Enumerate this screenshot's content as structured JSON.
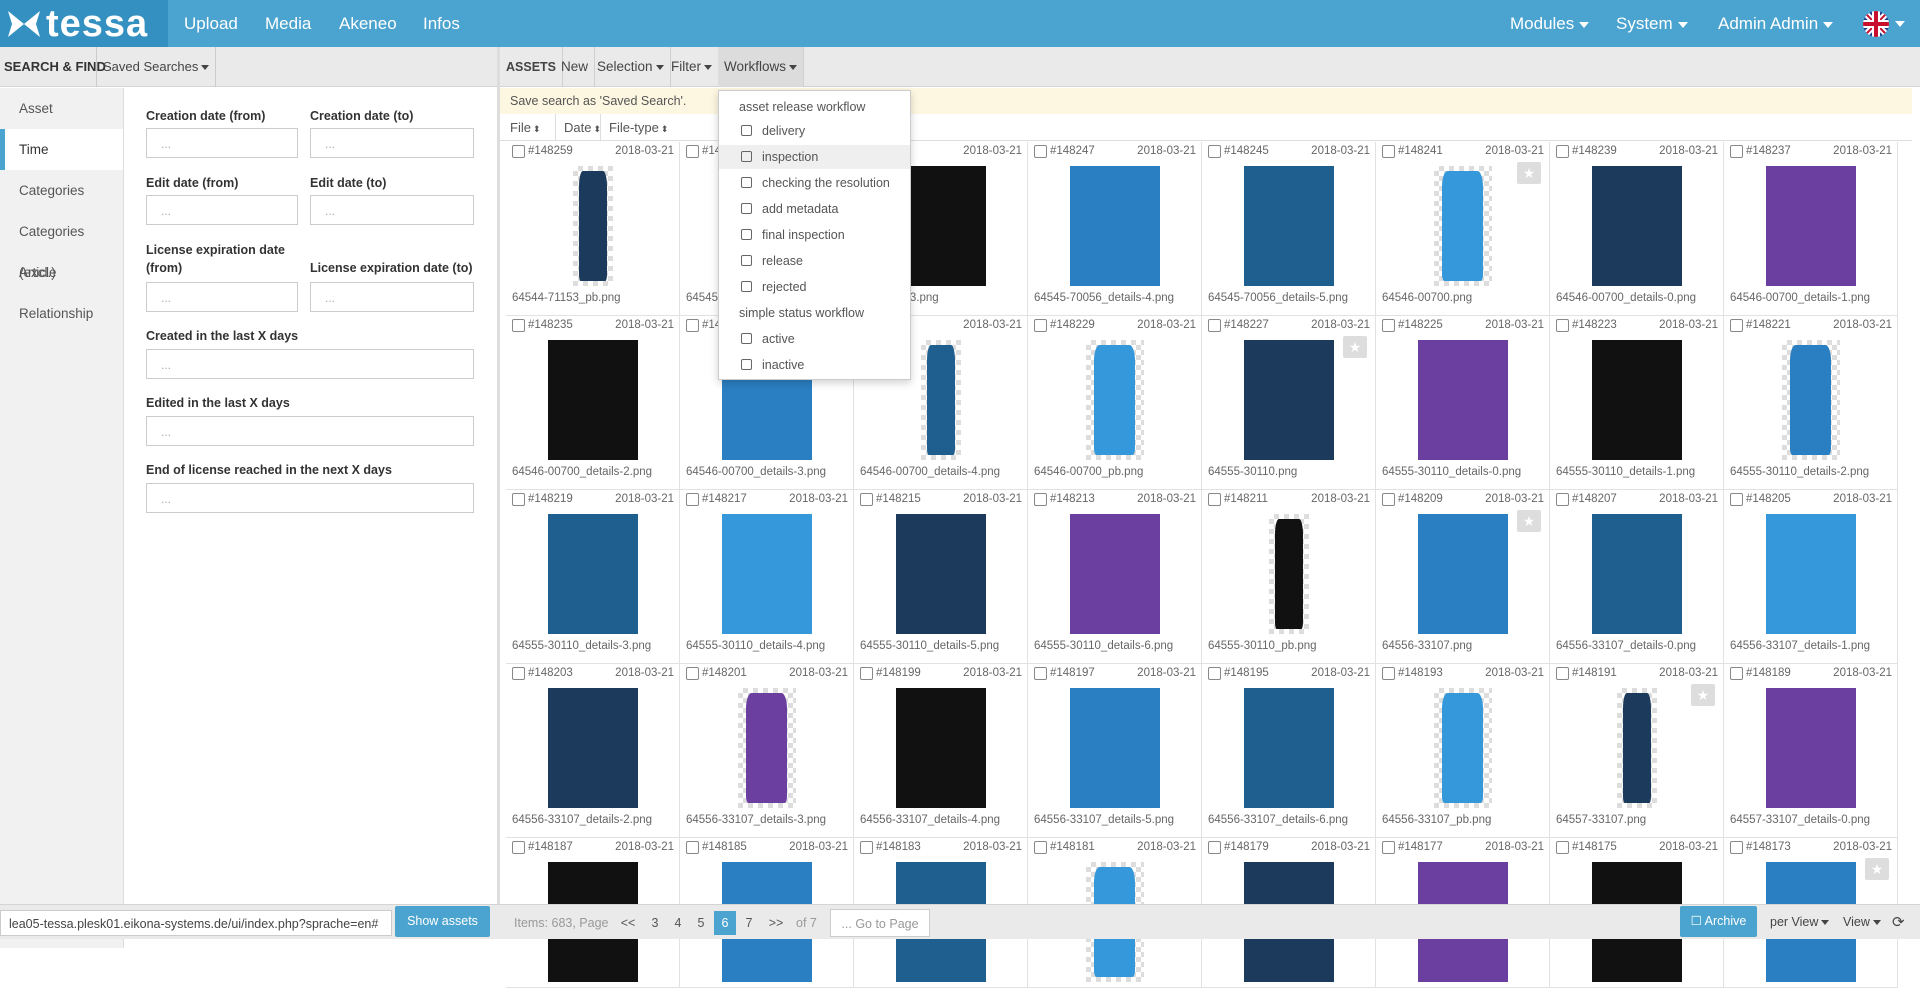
{
  "app": {
    "logo_text": "tessa"
  },
  "nav": {
    "left": [
      "Upload",
      "Media",
      "Akeneo",
      "Infos"
    ],
    "modules": "Modules",
    "system": "System",
    "user": "Admin Admin"
  },
  "colors": {
    "accent": "#4ba3cf",
    "logo_bg": "#3390c1",
    "save_bar": "#fdf7e1"
  },
  "search": {
    "title": "SEARCH & FIND",
    "saved_searches": "Saved Searches",
    "tabs": [
      "Asset",
      "Time",
      "Categories",
      "Categories (excl.)",
      "Article",
      "Relationship"
    ],
    "active_tab": "Time",
    "fields": {
      "creation_from": {
        "label": "Creation date (from)",
        "placeholder": "..."
      },
      "creation_to": {
        "label": "Creation date (to)",
        "placeholder": "..."
      },
      "edit_from": {
        "label": "Edit date (from)",
        "placeholder": "..."
      },
      "edit_to": {
        "label": "Edit date (to)",
        "placeholder": "..."
      },
      "license_from": {
        "label_1": "License expiration date",
        "label_2": "(from)",
        "placeholder": "..."
      },
      "license_to": {
        "label": "License expiration date (to)",
        "placeholder": "..."
      },
      "created_last": {
        "label": "Created in the last X days",
        "placeholder": "..."
      },
      "edited_last": {
        "label": "Edited in the last X days",
        "placeholder": "..."
      },
      "license_end": {
        "label": "End of license reached in the next X days",
        "placeholder": "..."
      }
    }
  },
  "toolbar": {
    "assets": "ASSETS",
    "new": "New",
    "selection": "Selection",
    "filter": "Filter",
    "workflows": "Workflows"
  },
  "save_search_text": "Save search as 'Saved Search'.",
  "sorts": [
    "File",
    "Date",
    "File-type"
  ],
  "dropdown": {
    "group1": "asset release workflow",
    "group1_items": [
      "delivery",
      "inspection",
      "checking the resolution",
      "add metadata",
      "final inspection",
      "release",
      "rejected"
    ],
    "group2": "simple status workflow",
    "group2_items": [
      "active",
      "inactive"
    ],
    "highlighted": "inspection"
  },
  "assets": [
    {
      "id": "#148259",
      "date": "2018-03-21",
      "file": "64544-71153_pb.png",
      "star": false
    },
    {
      "id": "#14",
      "date": "",
      "file": "64545-",
      "star": false
    },
    {
      "id": "",
      "date": "2018-03-21",
      "file": "6_details-3.png",
      "star": false
    },
    {
      "id": "#148247",
      "date": "2018-03-21",
      "file": "64545-70056_details-4.png",
      "star": false
    },
    {
      "id": "#148245",
      "date": "2018-03-21",
      "file": "64545-70056_details-5.png",
      "star": false
    },
    {
      "id": "#148241",
      "date": "2018-03-21",
      "file": "64546-00700.png",
      "star": true
    },
    {
      "id": "#148239",
      "date": "2018-03-21",
      "file": "64546-00700_details-0.png",
      "star": false
    },
    {
      "id": "#148237",
      "date": "2018-03-21",
      "file": "64546-00700_details-1.png",
      "star": false
    },
    {
      "id": "#148235",
      "date": "2018-03-21",
      "file": "64546-00700_details-2.png",
      "star": false
    },
    {
      "id": "#14",
      "date": "",
      "file": "64546-00700_details-3.png",
      "star": false
    },
    {
      "id": "",
      "date": "2018-03-21",
      "file": "64546-00700_details-4.png",
      "star": false
    },
    {
      "id": "#148229",
      "date": "2018-03-21",
      "file": "64546-00700_pb.png",
      "star": false
    },
    {
      "id": "#148227",
      "date": "2018-03-21",
      "file": "64555-30110.png",
      "star": true
    },
    {
      "id": "#148225",
      "date": "2018-03-21",
      "file": "64555-30110_details-0.png",
      "star": false
    },
    {
      "id": "#148223",
      "date": "2018-03-21",
      "file": "64555-30110_details-1.png",
      "star": false
    },
    {
      "id": "#148221",
      "date": "2018-03-21",
      "file": "64555-30110_details-2.png",
      "star": false
    },
    {
      "id": "#148219",
      "date": "2018-03-21",
      "file": "64555-30110_details-3.png",
      "star": false
    },
    {
      "id": "#148217",
      "date": "2018-03-21",
      "file": "64555-30110_details-4.png",
      "star": false
    },
    {
      "id": "#148215",
      "date": "2018-03-21",
      "file": "64555-30110_details-5.png",
      "star": false
    },
    {
      "id": "#148213",
      "date": "2018-03-21",
      "file": "64555-30110_details-6.png",
      "star": false
    },
    {
      "id": "#148211",
      "date": "2018-03-21",
      "file": "64555-30110_pb.png",
      "star": false
    },
    {
      "id": "#148209",
      "date": "2018-03-21",
      "file": "64556-33107.png",
      "star": true
    },
    {
      "id": "#148207",
      "date": "2018-03-21",
      "file": "64556-33107_details-0.png",
      "star": false
    },
    {
      "id": "#148205",
      "date": "2018-03-21",
      "file": "64556-33107_details-1.png",
      "star": false
    },
    {
      "id": "#148203",
      "date": "2018-03-21",
      "file": "64556-33107_details-2.png",
      "star": false
    },
    {
      "id": "#148201",
      "date": "2018-03-21",
      "file": "64556-33107_details-3.png",
      "star": false
    },
    {
      "id": "#148199",
      "date": "2018-03-21",
      "file": "64556-33107_details-4.png",
      "star": false
    },
    {
      "id": "#148197",
      "date": "2018-03-21",
      "file": "64556-33107_details-5.png",
      "star": false
    },
    {
      "id": "#148195",
      "date": "2018-03-21",
      "file": "64556-33107_details-6.png",
      "star": false
    },
    {
      "id": "#148193",
      "date": "2018-03-21",
      "file": "64556-33107_pb.png",
      "star": false
    },
    {
      "id": "#148191",
      "date": "2018-03-21",
      "file": "64557-33107.png",
      "star": true
    },
    {
      "id": "#148189",
      "date": "2018-03-21",
      "file": "64557-33107_details-0.png",
      "star": false
    },
    {
      "id": "#148187",
      "date": "2018-03-21",
      "file": "",
      "star": false
    },
    {
      "id": "#148185",
      "date": "2018-03-21",
      "file": "",
      "star": false
    },
    {
      "id": "#148183",
      "date": "2018-03-21",
      "file": "",
      "star": false
    },
    {
      "id": "#148181",
      "date": "2018-03-21",
      "file": "",
      "star": false
    },
    {
      "id": "#148179",
      "date": "2018-03-21",
      "file": "",
      "star": false
    },
    {
      "id": "#148177",
      "date": "2018-03-21",
      "file": "",
      "star": false
    },
    {
      "id": "#148175",
      "date": "2018-03-21",
      "file": "",
      "star": false
    },
    {
      "id": "#148173",
      "date": "2018-03-21",
      "file": "",
      "star": true
    }
  ],
  "footer": {
    "url": "lea05-tessa.plesk01.eikona-systems.de/ui/index.php?sprache=en#",
    "show_assets": "Show assets",
    "items_label": "Items: 683, Page",
    "first": "<<",
    "pages": [
      "3",
      "4",
      "5",
      "6",
      "7"
    ],
    "current_page": "6",
    "last": ">>",
    "of": "of 7",
    "goto_placeholder": "... Go to Page",
    "archive": "Archive",
    "per_view": "per View",
    "view": "View"
  }
}
